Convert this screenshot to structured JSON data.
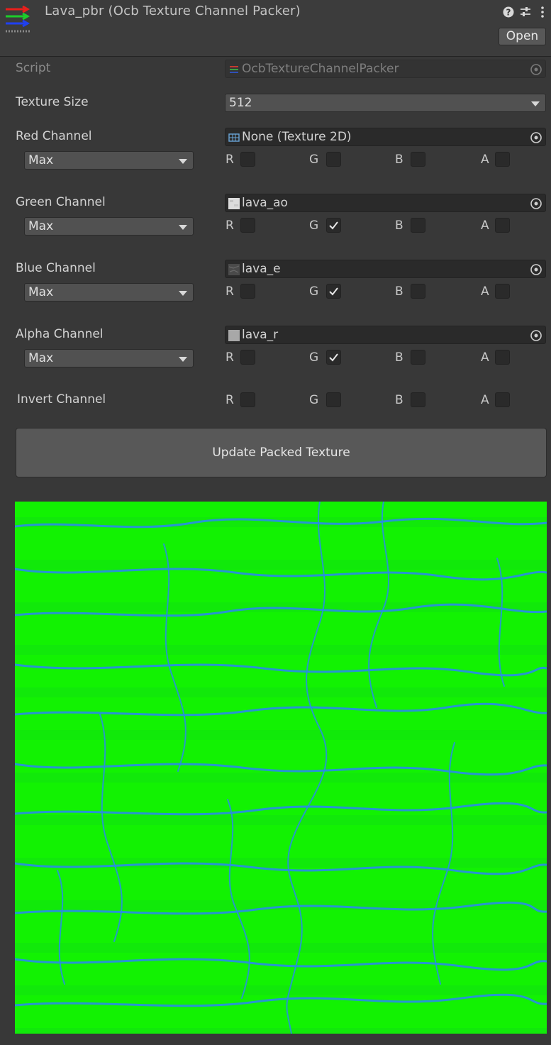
{
  "header": {
    "title": "Lava_pbr (Ocb Texture Channel Packer)",
    "open_label": "Open",
    "icons": [
      "help-icon",
      "presets-icon",
      "more-menu-icon"
    ]
  },
  "script_row": {
    "label": "Script",
    "value": "OcbTextureChannelPacker"
  },
  "texture_size": {
    "label": "Texture Size",
    "value": "512"
  },
  "channels": [
    {
      "label": "Red Channel",
      "texture": "None (Texture 2D)",
      "mode": "Max",
      "checks": {
        "R": false,
        "G": false,
        "B": false,
        "A": false
      }
    },
    {
      "label": "Green Channel",
      "texture": "lava_ao",
      "mode": "Max",
      "checks": {
        "R": false,
        "G": true,
        "B": false,
        "A": false
      }
    },
    {
      "label": "Blue Channel",
      "texture": "lava_e",
      "mode": "Max",
      "checks": {
        "R": false,
        "G": true,
        "B": false,
        "A": false
      }
    },
    {
      "label": "Alpha Channel",
      "texture": "lava_r",
      "mode": "Max",
      "checks": {
        "R": false,
        "G": true,
        "B": false,
        "A": false
      }
    }
  ],
  "channel_letters": {
    "r": "R",
    "g": "G",
    "b": "B",
    "a": "A"
  },
  "invert": {
    "label": "Invert Channel",
    "checks": {
      "R": false,
      "G": false,
      "B": false,
      "A": false
    }
  },
  "update_button": {
    "label": "Update Packed Texture"
  },
  "colors": {
    "background": "#383838",
    "preview_green": "#10f000",
    "crack_blue": "#2a8ce8"
  }
}
